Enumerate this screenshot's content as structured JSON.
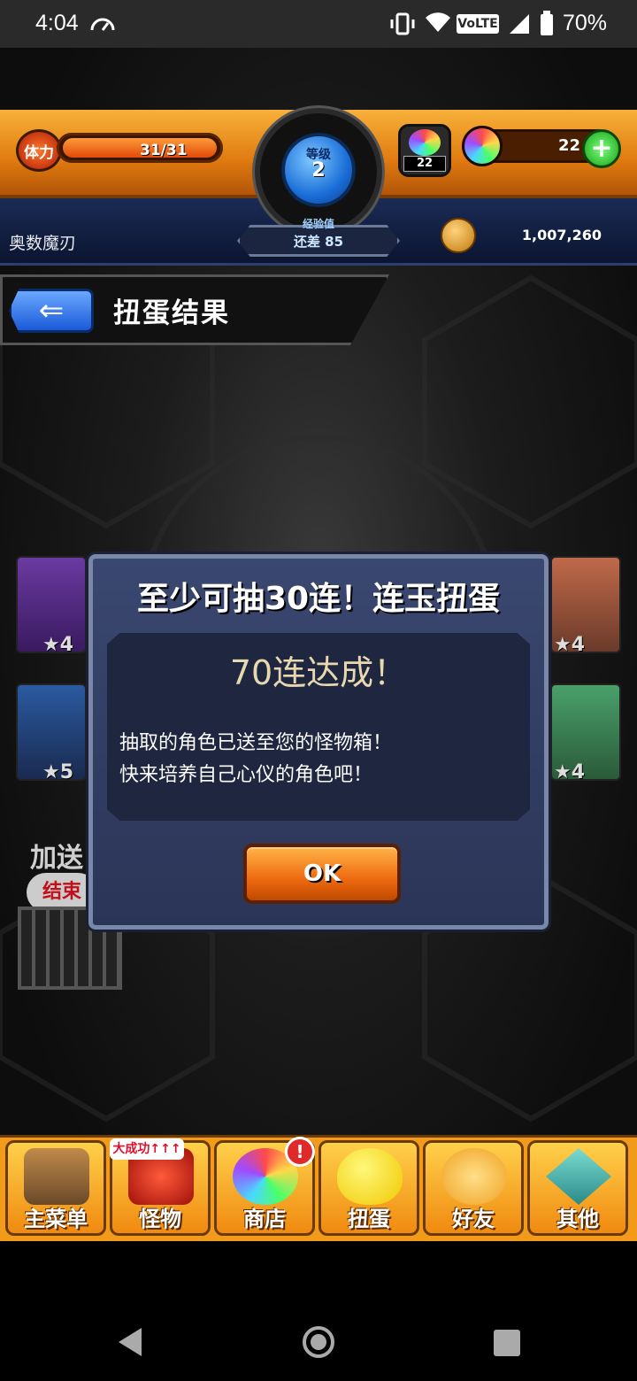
{
  "status_bar": {
    "time": "4:04",
    "battery_percent": "70%",
    "network": "VoLTE"
  },
  "hud": {
    "stamina_icon_label": "体力",
    "stamina": "31/31",
    "stamina_fraction": 1.0,
    "level_label": "等级",
    "level": "2",
    "exp_label": "经验值",
    "exp_remaining": "还差 85",
    "item_count": "22",
    "orbs": "22",
    "player_name": "奥数魔刃",
    "coins": "1,007,260"
  },
  "page": {
    "title": "扭蛋结果"
  },
  "background": {
    "card_stars": [
      "★4",
      "★4",
      "★5",
      "★4"
    ],
    "bonus_label": "加送",
    "bonus_badge": "结束"
  },
  "dialog": {
    "title": "至少可抽30连！连玉扭蛋",
    "headline": "70连达成！",
    "line1": "抽取的角色已送至您的怪物箱！",
    "line2": "快来培养自己心仪的角色吧！",
    "ok_label": "OK"
  },
  "bottom_nav": {
    "items": [
      {
        "label": "主菜单",
        "icon": "gate-icon"
      },
      {
        "label": "怪物",
        "icon": "monster-icon"
      },
      {
        "label": "商店",
        "icon": "orb-icon"
      },
      {
        "label": "扭蛋",
        "icon": "egg-icon"
      },
      {
        "label": "好友",
        "icon": "balloons-icon"
      },
      {
        "label": "其他",
        "icon": "question-icon"
      }
    ],
    "monster_ribbon": "大成功↑↑↑",
    "shop_badge": "!"
  },
  "colors": {
    "hud_orange": "#f29a1a",
    "dialog_bg": "#2b3557",
    "ok_orange": "#ee6a10"
  }
}
